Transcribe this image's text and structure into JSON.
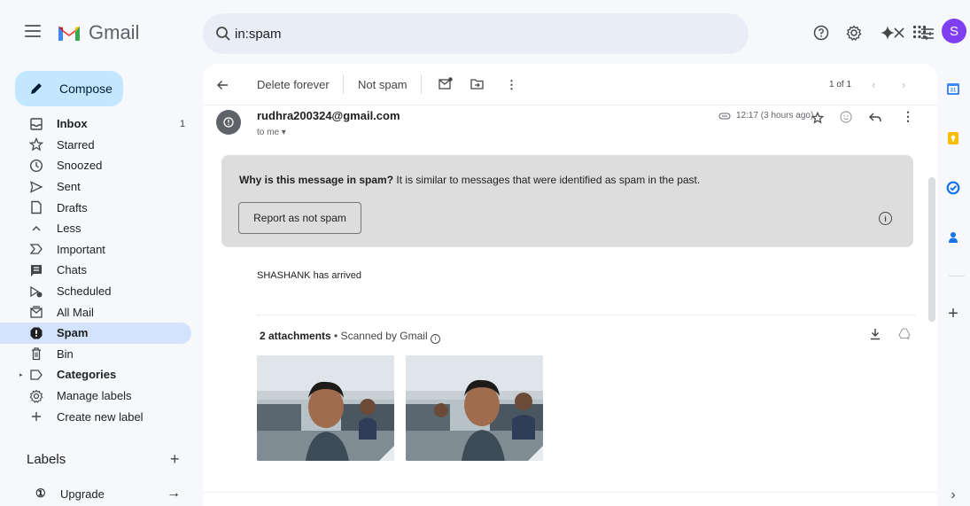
{
  "app": {
    "name": "Gmail",
    "search_value": "in:spam",
    "avatar_letter": "S"
  },
  "compose_label": "Compose",
  "nav": [
    {
      "label": "Inbox",
      "count": "1",
      "icon": "inbox-icon",
      "bold": true
    },
    {
      "label": "Starred",
      "count": "",
      "icon": "star-icon"
    },
    {
      "label": "Snoozed",
      "count": "",
      "icon": "clock-icon"
    },
    {
      "label": "Sent",
      "count": "",
      "icon": "send-icon"
    },
    {
      "label": "Drafts",
      "count": "",
      "icon": "draft-icon"
    },
    {
      "label": "Less",
      "count": "",
      "icon": "chevron-up-icon"
    },
    {
      "label": "Important",
      "count": "",
      "icon": "important-icon"
    },
    {
      "label": "Chats",
      "count": "",
      "icon": "chat-icon"
    },
    {
      "label": "Scheduled",
      "count": "",
      "icon": "scheduled-icon"
    },
    {
      "label": "All Mail",
      "count": "",
      "icon": "all-mail-icon"
    },
    {
      "label": "Spam",
      "count": "",
      "icon": "spam-icon",
      "bold": true,
      "active": true
    },
    {
      "label": "Bin",
      "count": "",
      "icon": "bin-icon"
    },
    {
      "label": "Categories",
      "count": "",
      "icon": "label-icon",
      "bold": true
    },
    {
      "label": "Manage labels",
      "count": "",
      "icon": "gear-icon"
    },
    {
      "label": "Create new label",
      "count": "",
      "icon": "plus-icon"
    }
  ],
  "labels_heading": "Labels",
  "upgrade_label": "Upgrade",
  "toolbar": {
    "delete_forever": "Delete forever",
    "not_spam": "Not spam",
    "pager": "1 of 1"
  },
  "message": {
    "sender": "rudhra200324@gmail.com",
    "to": "to me",
    "time": "12:17 (3 hours ago)",
    "spam_question": "Why is this message in spam?",
    "spam_reason": "It is similar to messages that were identified as spam in the past.",
    "report_button": "Report as not spam",
    "body": "SHASHANK has arrived",
    "attachments_count": "2 attachments",
    "scanned": "• Scanned by Gmail"
  },
  "colors": {
    "compose_bg": "#c2e7ff",
    "active_nav": "#d3e3fd",
    "search_bg": "#e9eef6",
    "spam_box_bg": "#dddddd",
    "avatar_bg": "#7e3ff2"
  }
}
